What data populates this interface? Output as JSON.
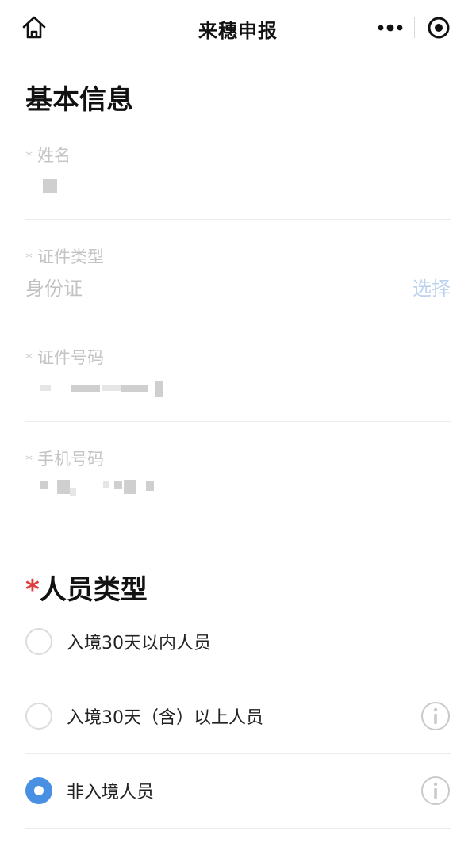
{
  "nav": {
    "title": "来穗申报",
    "icons": {
      "home": "home-icon",
      "more": "more-dots-icon",
      "close": "target-close-icon"
    }
  },
  "basic_info": {
    "title": "基本信息",
    "fields": [
      {
        "label": "姓名",
        "required": true,
        "value": ""
      },
      {
        "label": "证件类型",
        "required": true,
        "value": "身份证",
        "action": "选择"
      },
      {
        "label": "证件号码",
        "required": true,
        "value": ""
      },
      {
        "label": "手机号码",
        "required": true,
        "value": ""
      }
    ]
  },
  "person_type": {
    "required_mark": "*",
    "title": "人员类型",
    "options": [
      {
        "label": "入境30天以内人员",
        "checked": false,
        "has_info": false
      },
      {
        "label": "入境30天（含）以上人员",
        "checked": false,
        "has_info": true
      },
      {
        "label": "非入境人员",
        "checked": true,
        "has_info": true
      }
    ]
  },
  "colors": {
    "accent": "#4a90e2",
    "required": "#e03b3b",
    "action": "#bcd2ee"
  }
}
